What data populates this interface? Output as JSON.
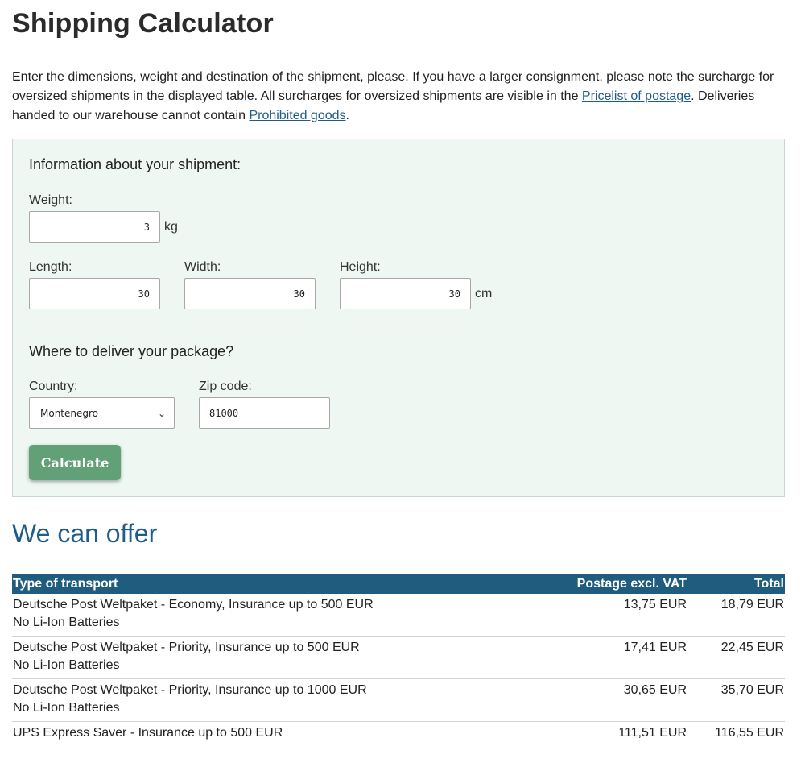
{
  "page": {
    "title": "Shipping Calculator",
    "intro": {
      "part1": "Enter the dimensions, weight and destination of the shipment, please. If you have a larger consignment, please note the surcharge for oversized shipments in the displayed table. All surcharges for oversized shipments are visible in the ",
      "link1": "Pricelist of postage",
      "part2": ". Deliveries handed to our warehouse cannot contain ",
      "link2": "Prohibited goods",
      "part3": "."
    }
  },
  "form": {
    "shipment_heading": "Information about your shipment:",
    "weight_label": "Weight:",
    "weight_value": "3",
    "weight_unit": "kg",
    "length_label": "Length:",
    "length_value": "30",
    "width_label": "Width:",
    "width_value": "30",
    "height_label": "Height:",
    "height_value": "30",
    "dim_unit": "cm",
    "delivery_heading": "Where to deliver your package?",
    "country_label": "Country:",
    "country_value": "Montenegro",
    "zip_label": "Zip code:",
    "zip_value": "81000",
    "calculate_label": "Calculate"
  },
  "results": {
    "heading": "We can offer",
    "columns": {
      "type": "Type of transport",
      "postage": "Postage excl. VAT",
      "total": "Total"
    },
    "rows": [
      {
        "name": "Deutsche Post Weltpaket - Economy, Insurance up to 500 EUR",
        "note": "No Li-Ion Batteries",
        "postage": "13,75 EUR",
        "total": "18,79 EUR"
      },
      {
        "name": "Deutsche Post Weltpaket - Priority, Insurance up to 500 EUR",
        "note": "No Li-Ion Batteries",
        "postage": "17,41 EUR",
        "total": "22,45 EUR"
      },
      {
        "name": "Deutsche Post Weltpaket - Priority, Insurance up to 1000 EUR",
        "note": "No Li-Ion Batteries",
        "postage": "30,65 EUR",
        "total": "35,70 EUR"
      },
      {
        "name": "UPS Express Saver - Insurance up to 500 EUR",
        "postage": "111,51 EUR",
        "total": "116,55 EUR"
      }
    ]
  },
  "colors": {
    "accent": "#1f5c8a",
    "table_header": "#1f5c7e",
    "button": "#62a078",
    "panel_bg": "#eef7f1"
  }
}
